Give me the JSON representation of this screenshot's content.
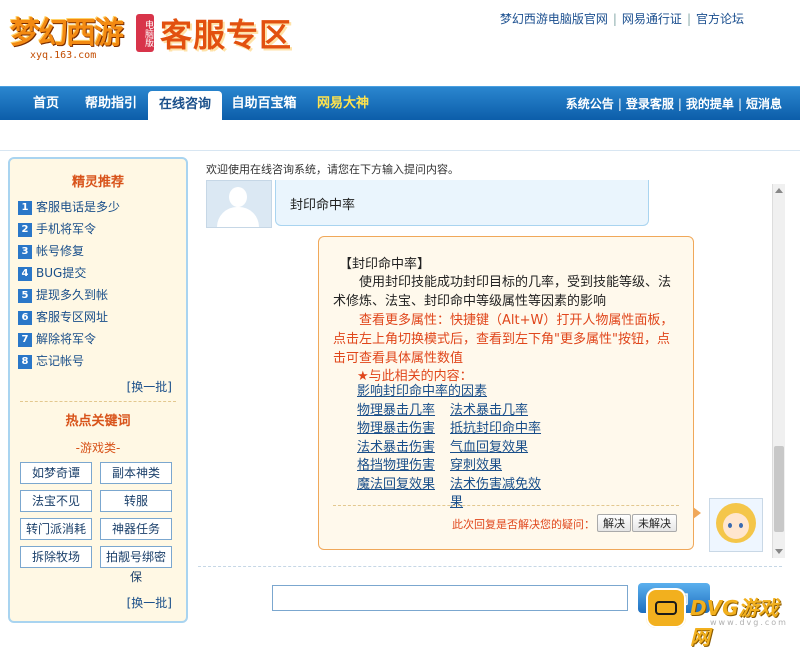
{
  "header": {
    "logo_text": "梦幻西游",
    "logo_badge": "电脑版",
    "logo_url_text": "xyq.163.com",
    "zone_title": "客服专区",
    "top_links": [
      "梦幻西游电脑版官网",
      "网易通行证",
      "官方论坛"
    ]
  },
  "nav": {
    "tabs": [
      "首页",
      "帮助指引",
      "在线咨询",
      "自助百宝箱",
      "网易大神"
    ],
    "active_tab": "在线咨询",
    "right_links": [
      "系统公告",
      "登录客服",
      "我的提单",
      "短消息"
    ]
  },
  "sidebar": {
    "recommend_title": "精灵推荐",
    "faq": [
      {
        "num": "1",
        "label": "客服电话是多少"
      },
      {
        "num": "2",
        "label": "手机将军令"
      },
      {
        "num": "3",
        "label": "帐号修复"
      },
      {
        "num": "4",
        "label": "BUG提交"
      },
      {
        "num": "5",
        "label": "提现多久到帐"
      },
      {
        "num": "6",
        "label": "客服专区网址"
      },
      {
        "num": "7",
        "label": "解除将军令"
      },
      {
        "num": "8",
        "label": "忘记帐号"
      }
    ],
    "change_label": "[换一批]",
    "keywords_title": "热点关键词",
    "keyword_category": "-游戏类-",
    "keywords": [
      "如梦奇谭",
      "副本神类",
      "法宝不见",
      "转服",
      "转门派消耗",
      "神器任务",
      "拆除牧场",
      "拍靓号绑密保"
    ],
    "change_label_bottom": "[换一批]"
  },
  "chat": {
    "welcome": "欢迎使用在线咨询系统，请您在下方输入提问内容。",
    "user_question": "封印命中率",
    "answer_title": "【封印命中率】",
    "answer_body": "使用封印技能成功封印目标的几率，受到技能等级、法术修炼、法宝、封印命中等级属性等因素的影响",
    "answer_more": "查看更多属性：快捷键（Alt+W）打开人物属性面板，点击左上角切换模式后，查看到左下角\"更多属性\"按钮，点击可查看具体属性数值",
    "related_title": "★与此相关的内容：",
    "related_first": "影响封印命中率的因素",
    "related_pairs": [
      [
        "物理暴击几率",
        "法术暴击几率"
      ],
      [
        "物理暴击伤害",
        "抵抗封印命中率"
      ],
      [
        "法术暴击伤害",
        "气血回复效果"
      ],
      [
        "格挡物理伤害",
        "穿刺效果"
      ],
      [
        "魔法回复效果",
        "法术伤害减免效果"
      ]
    ],
    "feedback_question": "此次回复是否解决您的疑问：",
    "resolved_label": "解决",
    "unresolved_label": "未解决",
    "input_value": "",
    "send_label": "发 问"
  },
  "watermark": {
    "text": "DVG游戏网",
    "sub": "www.dvg.com"
  }
}
